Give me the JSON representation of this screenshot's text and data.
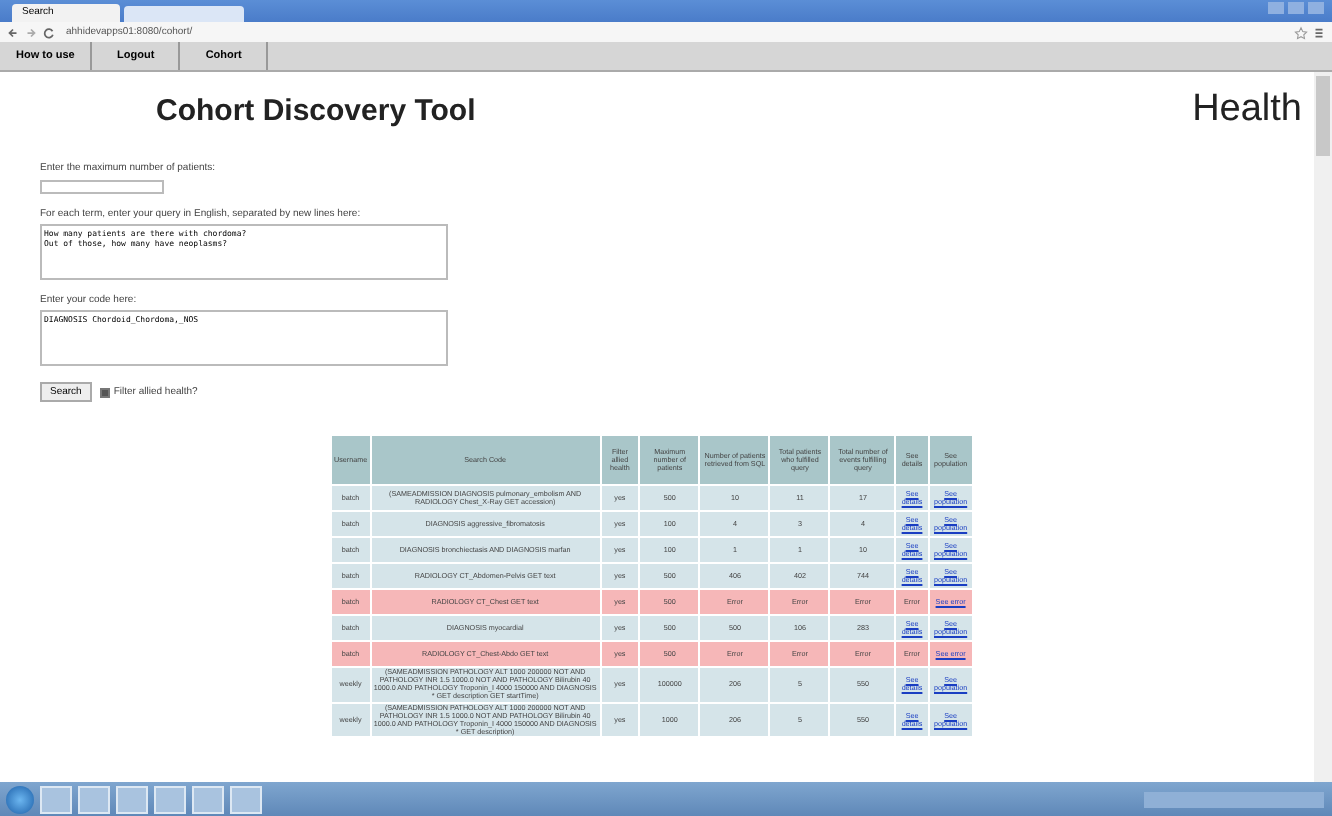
{
  "browser": {
    "tab_title": "Search",
    "address": "ahhidevapps01:8080/cohort/"
  },
  "nav": [
    {
      "label": "How to use"
    },
    {
      "label": "Logout"
    },
    {
      "label": "Cohort"
    }
  ],
  "title": "Cohort Discovery Tool",
  "brand": "Health",
  "max_patients": {
    "label": "Enter the maximum number of patients:"
  },
  "query": {
    "label": "For each term, enter your query in English, separated by new lines here:",
    "value": "How many patients are there with chordoma?\nOut of those, how many have neoplasms?"
  },
  "code": {
    "label": "Enter your code here:",
    "value": "DIAGNOSIS Chordoid_Chordoma,_NOS"
  },
  "search_button": "Search",
  "filter": {
    "label": "Filter allied health?",
    "checked": true
  },
  "table": {
    "columns": [
      "Username",
      "Search Code",
      "Filter allied health",
      "Maximum number of patients",
      "Number of patients retrieved from SQL",
      "Total patients who fulfilled query",
      "Total number of events fulfilling query",
      "See details",
      "See population"
    ],
    "rows": [
      {
        "error": false,
        "cells": [
          "batch",
          "(SAMEADMISSION DIAGNOSIS pulmonary_embolism AND RADIOLOGY Chest_X-Ray GET accession)",
          "yes",
          "500",
          "10",
          "11",
          "17"
        ],
        "details": "See details",
        "population": "See population"
      },
      {
        "error": false,
        "cells": [
          "batch",
          "DIAGNOSIS aggressive_fibromatosis",
          "yes",
          "100",
          "4",
          "3",
          "4"
        ],
        "details": "See details",
        "population": "See population"
      },
      {
        "error": false,
        "cells": [
          "batch",
          "DIAGNOSIS bronchiectasis AND DIAGNOSIS marfan",
          "yes",
          "100",
          "1",
          "1",
          "10"
        ],
        "details": "See details",
        "population": "See population"
      },
      {
        "error": false,
        "cells": [
          "batch",
          "RADIOLOGY CT_Abdomen-Pelvis GET text",
          "yes",
          "500",
          "406",
          "402",
          "744"
        ],
        "details": "See details",
        "population": "See population"
      },
      {
        "error": true,
        "cells": [
          "batch",
          "RADIOLOGY CT_Chest GET text",
          "yes",
          "500",
          "Error",
          "Error",
          "Error"
        ],
        "details": "Error",
        "population": "See error"
      },
      {
        "error": false,
        "cells": [
          "batch",
          "DIAGNOSIS myocardial",
          "yes",
          "500",
          "500",
          "106",
          "283"
        ],
        "details": "See details",
        "population": "See population"
      },
      {
        "error": true,
        "cells": [
          "batch",
          "RADIOLOGY CT_Chest-Abdo GET text",
          "yes",
          "500",
          "Error",
          "Error",
          "Error"
        ],
        "details": "Error",
        "population": "See error"
      },
      {
        "error": false,
        "cells": [
          "weekly",
          "(SAMEADMISSION PATHOLOGY ALT 1000 200000 NOT AND PATHOLOGY INR 1.5 1000.0 NOT AND PATHOLOGY Bilirubin 40 1000.0 AND PATHOLOGY Troponin_I 4000 150000 AND DIAGNOSIS * GET description GET startTime)",
          "yes",
          "100000",
          "206",
          "5",
          "550"
        ],
        "details": "See details",
        "population": "See population"
      },
      {
        "error": false,
        "cells": [
          "weekly",
          "(SAMEADMISSION PATHOLOGY ALT 1000 200000 NOT AND PATHOLOGY INR 1.5 1000.0 NOT AND PATHOLOGY Bilirubin 40 1000.0 AND PATHOLOGY Troponin_I 4000 150000 AND DIAGNOSIS * GET description)",
          "yes",
          "1000",
          "206",
          "5",
          "550"
        ],
        "details": "See details",
        "population": "See population"
      }
    ]
  }
}
